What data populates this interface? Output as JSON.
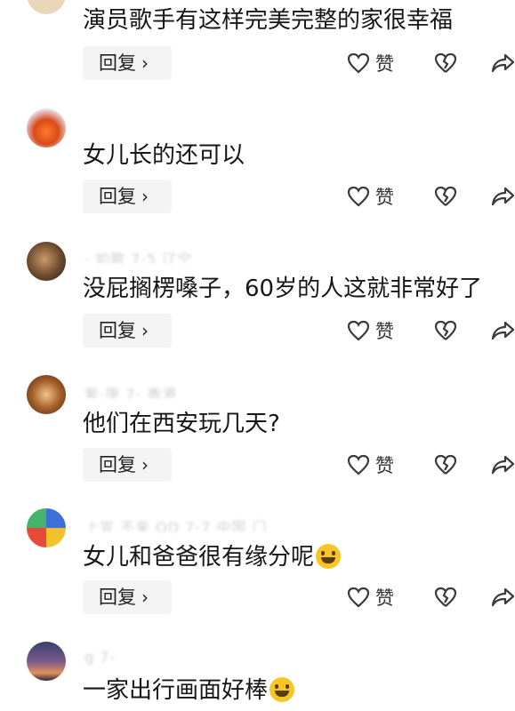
{
  "comments": [
    {
      "meta": "",
      "text": "演员歌手有这样完美完整的家很幸福",
      "reply": "回复",
      "like": "赞"
    },
    {
      "meta": "",
      "text": "女儿长的还可以",
      "reply": "回复",
      "like": "赞"
    },
    {
      "meta": "·  如歌  7-5  辽宁",
      "text": "没屁搁楞嗓子，60岁的人这就非常好了",
      "reply": "回复",
      "like": "赞"
    },
    {
      "meta": "紫·庚  7-    香港",
      "text": "他们在西安玩几天?",
      "reply": "回复",
      "like": "赞"
    },
    {
      "meta": "上宜  不来 OD  7-7  中国  门",
      "text": "女儿和爸爸很有缘分呢",
      "reply": "回复",
      "like": "赞"
    },
    {
      "meta": "          g       7-",
      "text": "一家出行画面好棒",
      "reply": "",
      "like": ""
    }
  ],
  "colors": {
    "icon": "#3a3a3a",
    "reply_bg": "#f4f4f4",
    "emoji": "#f7c624"
  }
}
